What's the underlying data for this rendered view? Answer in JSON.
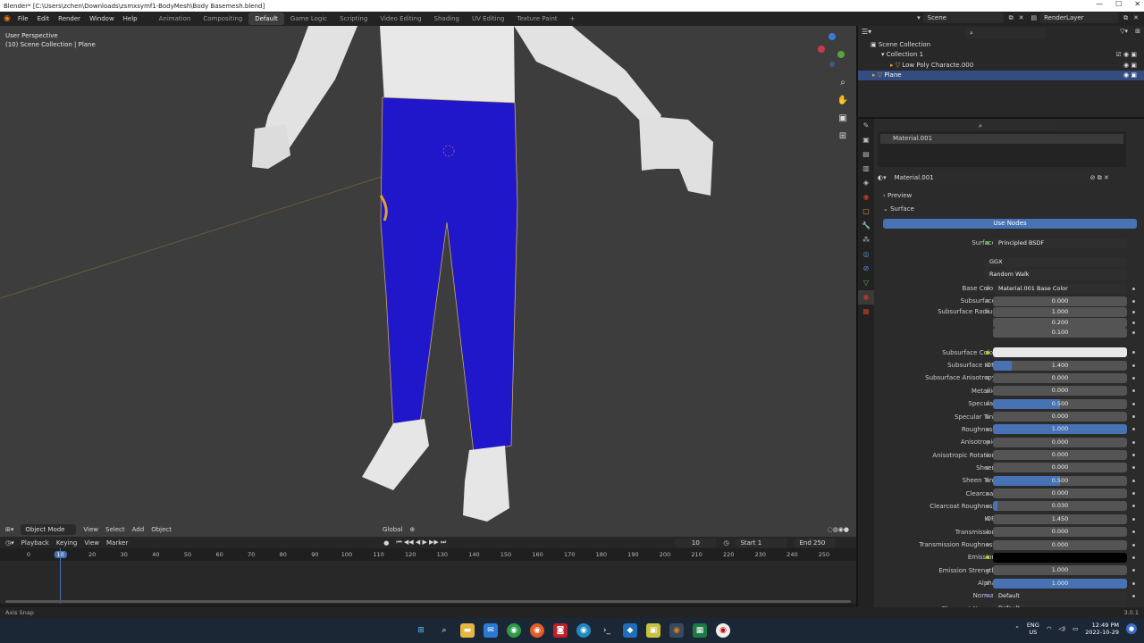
{
  "window": {
    "title": "Blender* [C:\\Users\\zchen\\Downloads\\zsmxsymf1-BodyMesh\\Body Basemesh.blend]"
  },
  "menu": {
    "items": [
      "File",
      "Edit",
      "Render",
      "Window",
      "Help"
    ]
  },
  "workspaces": [
    "Animation",
    "Compositing",
    "Default",
    "Game Logic",
    "Scripting",
    "Video Editing",
    "Shading",
    "UV Editing",
    "Texture Paint",
    "+"
  ],
  "scene": {
    "name": "Scene",
    "render_layer": "RenderLayer"
  },
  "viewport": {
    "perspective": "User Perspective",
    "collection_info": "(10) Scene Collection | Plane",
    "mode": "Object Mode",
    "menus": [
      "View",
      "Select",
      "Add",
      "Object"
    ],
    "transform": "Global"
  },
  "timeline": {
    "menus": [
      "Playback",
      "Keying",
      "View",
      "Marker"
    ],
    "current_frame": "10",
    "start_label": "Start",
    "start": "1",
    "end_label": "End",
    "end": "250",
    "ticks": [
      "0",
      "10",
      "20",
      "30",
      "40",
      "50",
      "60",
      "70",
      "80",
      "90",
      "100",
      "110",
      "120",
      "130",
      "140",
      "150",
      "160",
      "170",
      "180",
      "190",
      "200",
      "210",
      "220",
      "230",
      "240",
      "250"
    ]
  },
  "outliner": {
    "root": "Scene Collection",
    "items": [
      "Collection 1",
      "Low Poly Characte.000",
      "Plane"
    ]
  },
  "properties": {
    "slot": "Material.001",
    "material": "Material.001",
    "sections": {
      "preview": "Preview",
      "surface": "Surface"
    },
    "use_nodes": "Use Nodes",
    "surface_label": "Surface",
    "surface_value": "Principled BSDF",
    "distribution": "GGX",
    "subsurface_method": "Random Walk",
    "rows": [
      {
        "label": "Base Color",
        "value": "Material.001 Base Color",
        "type": "link"
      },
      {
        "label": "Subsurface",
        "value": "0.000",
        "fill": 0
      },
      {
        "label": "Subsurface Radius",
        "value": "1.000",
        "fill": 0
      },
      {
        "label": "",
        "value": "0.200",
        "fill": 0
      },
      {
        "label": "",
        "value": "0.100",
        "fill": 0
      },
      {
        "label": "Subsurface Color",
        "value": "",
        "type": "color",
        "color": "#e8e8e8"
      },
      {
        "label": "Subsurface IOR",
        "value": "1.400",
        "fill": 0.14
      },
      {
        "label": "Subsurface Anisotropy",
        "value": "0.000",
        "fill": 0
      },
      {
        "label": "Metallic",
        "value": "0.000",
        "fill": 0
      },
      {
        "label": "Specular",
        "value": "0.500",
        "fill": 0.5
      },
      {
        "label": "Specular Tint",
        "value": "0.000",
        "fill": 0
      },
      {
        "label": "Roughness",
        "value": "1.000",
        "fill": 1
      },
      {
        "label": "Anisotropic",
        "value": "0.000",
        "fill": 0
      },
      {
        "label": "Anisotropic Rotation",
        "value": "0.000",
        "fill": 0
      },
      {
        "label": "Sheen",
        "value": "0.000",
        "fill": 0
      },
      {
        "label": "Sheen Tint",
        "value": "0.500",
        "fill": 0.5
      },
      {
        "label": "Clearcoat",
        "value": "0.000",
        "fill": 0
      },
      {
        "label": "Clearcoat Roughness",
        "value": "0.030",
        "fill": 0.03
      },
      {
        "label": "IOR",
        "value": "1.450",
        "fill": 0
      },
      {
        "label": "Transmission",
        "value": "0.000",
        "fill": 0
      },
      {
        "label": "Transmission Roughness",
        "value": "0.000",
        "fill": 0
      },
      {
        "label": "Emission",
        "value": "",
        "type": "color",
        "color": "#000000"
      },
      {
        "label": "Emission Strength",
        "value": "1.000",
        "fill": 0
      },
      {
        "label": "Alpha",
        "value": "1.000",
        "fill": 1
      },
      {
        "label": "Normal",
        "value": "Default",
        "type": "link"
      },
      {
        "label": "Clearcoat Normal",
        "value": "Default",
        "type": "link"
      }
    ]
  },
  "status": {
    "hint": "Axis Snap",
    "version": "3.0.1"
  },
  "tray": {
    "lang": "ENG",
    "region": "US",
    "time": "12:49 PM",
    "date": "2022-10-29"
  },
  "colors": {
    "accent": "#4772b3",
    "pants": "#1f17c9",
    "body": "#ededed"
  }
}
